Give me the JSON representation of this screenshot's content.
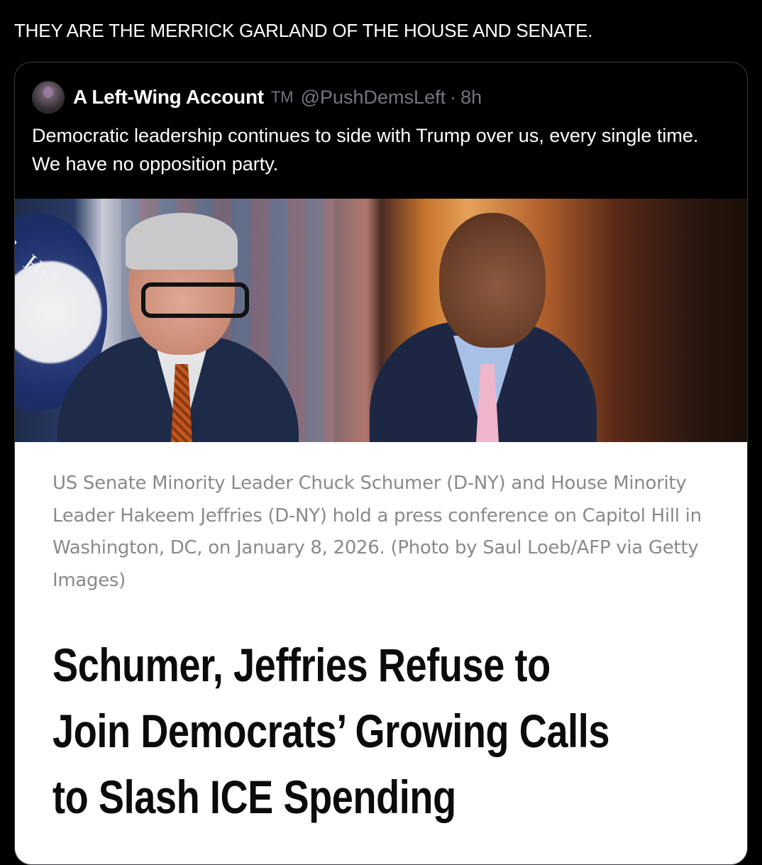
{
  "post": {
    "text": "THEY ARE THE MERRICK GARLAND OF THE HOUSE AND SENATE."
  },
  "quoted_post": {
    "display_name": "A Left-Wing Account",
    "badge": "TM",
    "handle": "@PushDemsLeft",
    "separator": "·",
    "time": "8h",
    "text": "Democratic leadership continues to side with Trump over us, every single time. We have no opposition party.",
    "avatar_icon": "user-avatar"
  },
  "photo": {
    "seal_text": "U.S. HO"
  },
  "article": {
    "caption": "US Senate Minority Leader Chuck Schumer (D-NY) and House Minority Leader Hakeem Jeffries (D-NY) hold a press conference on Capitol Hill in Washington, DC, on January 8, 2026.    (Photo by Saul Loeb/AFP via Getty Images)",
    "headline": "Schumer, Jeffries Refuse to Join Democrats’ Growing Calls to Slash ICE Spending"
  },
  "colors": {
    "background": "#000000",
    "text_primary": "#ffffff",
    "text_secondary": "#71767b",
    "card_border": "#3a3d40",
    "caption": "#8a8a8a",
    "headline": "#0b0b0b"
  }
}
